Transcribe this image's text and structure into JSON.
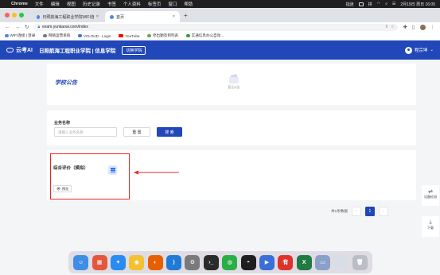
{
  "menubar": {
    "app": "Chrome",
    "items": [
      "文件",
      "编辑",
      "视图",
      "历史记录",
      "书签",
      "个人资料",
      "标签页",
      "窗口",
      "帮助"
    ],
    "right": {
      "user": "指迷",
      "input": "拼",
      "date": "2月19日 周日 16:05"
    }
  },
  "tabs": [
    {
      "label": "日照航海工程职业学院WIFI连接..."
    },
    {
      "label": "首页"
    }
  ],
  "address": {
    "url": "exam.yunkaoai.com/index"
  },
  "bookmarks": [
    {
      "label": "WIFI连接 | 登录",
      "color": "#4a88e8"
    },
    {
      "label": "网络运营系统",
      "color": "#7b7b7b"
    },
    {
      "label": "VCLOUD - Login",
      "color": "#3c78d8"
    },
    {
      "label": "YouTube",
      "color": "#ff0000"
    },
    {
      "label": "停出勤签到列表",
      "color": "#6aa84f"
    },
    {
      "label": "实通信息办公自动...",
      "color": "#3c9b3c"
    }
  ],
  "header": {
    "brand": "云考AI",
    "school": "日照航海工程职业学院 | 信息学院",
    "switch_label": "切换学院",
    "username": "程宗坤"
  },
  "notice": {
    "title": "学校公告",
    "empty_text": "暂无公告"
  },
  "search": {
    "label": "业务名称",
    "placeholder": "请输入业务名称",
    "reset_label": "重 置",
    "search_label": "搜 索"
  },
  "course": {
    "title": "综合评价（模拟）",
    "preview_label": "预览"
  },
  "pager": {
    "total": "共1条数据",
    "prev": "‹",
    "page": "1",
    "next": "›"
  },
  "float_tools": {
    "device": "设备检测",
    "download": "下载"
  },
  "dock_apps": [
    {
      "name": "Finder",
      "color": "#3f8ee6"
    },
    {
      "name": "Launchpad",
      "color": "#e4573d"
    },
    {
      "name": "Safari",
      "color": "#2a8bf2"
    },
    {
      "name": "Chrome",
      "color": "#f1c232"
    },
    {
      "name": "Firefox",
      "color": "#e66000"
    },
    {
      "name": "VS Code",
      "color": "#1f7bd6"
    },
    {
      "name": "System Settings",
      "color": "#7a7a7a"
    },
    {
      "name": "Terminal",
      "color": "#2b2b2b"
    },
    {
      "name": "WeChat",
      "color": "#2aae45"
    },
    {
      "name": "QQ",
      "color": "#1e1e1e"
    },
    {
      "name": "Video",
      "color": "#3b6fd8"
    },
    {
      "name": "Youdao",
      "color": "#e0322b"
    },
    {
      "name": "Excel",
      "color": "#1f7a43"
    },
    {
      "name": "Preview",
      "color": "#8aa0c8"
    },
    {
      "name": "Downloads",
      "color": "#d9dde5"
    },
    {
      "name": "Trash",
      "color": "#b9bec7"
    }
  ],
  "colors": {
    "brand": "#2147b9",
    "annotation": "#e8271c"
  }
}
